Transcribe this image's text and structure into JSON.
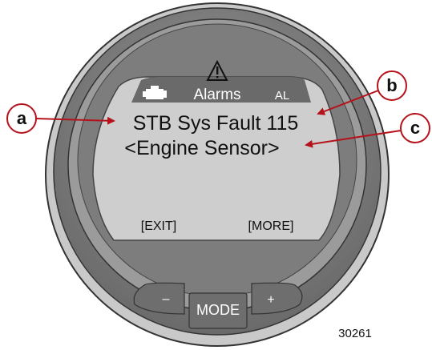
{
  "header": {
    "title": "Alarms",
    "indicator": "AL",
    "engine_icon": "engine-icon",
    "warning_icon": "warning-triangle-icon"
  },
  "screen": {
    "line1": "STB Sys Fault 115",
    "line2": "<Engine Sensor>",
    "softkey_left": "[EXIT]",
    "softkey_right": "[MORE]"
  },
  "buttons": {
    "minus": "–",
    "mode": "MODE",
    "plus": "+"
  },
  "callouts": [
    "a",
    "b",
    "c"
  ],
  "figure_number": "30261",
  "colors": {
    "callout_red": "#b5121b",
    "bezel_dark": "#5a5a5a",
    "bezel_light": "#8e8e8e",
    "lcd": "#cfcfcf",
    "lcd_header": "#6a6a6a",
    "button": "#6e6e6e"
  }
}
